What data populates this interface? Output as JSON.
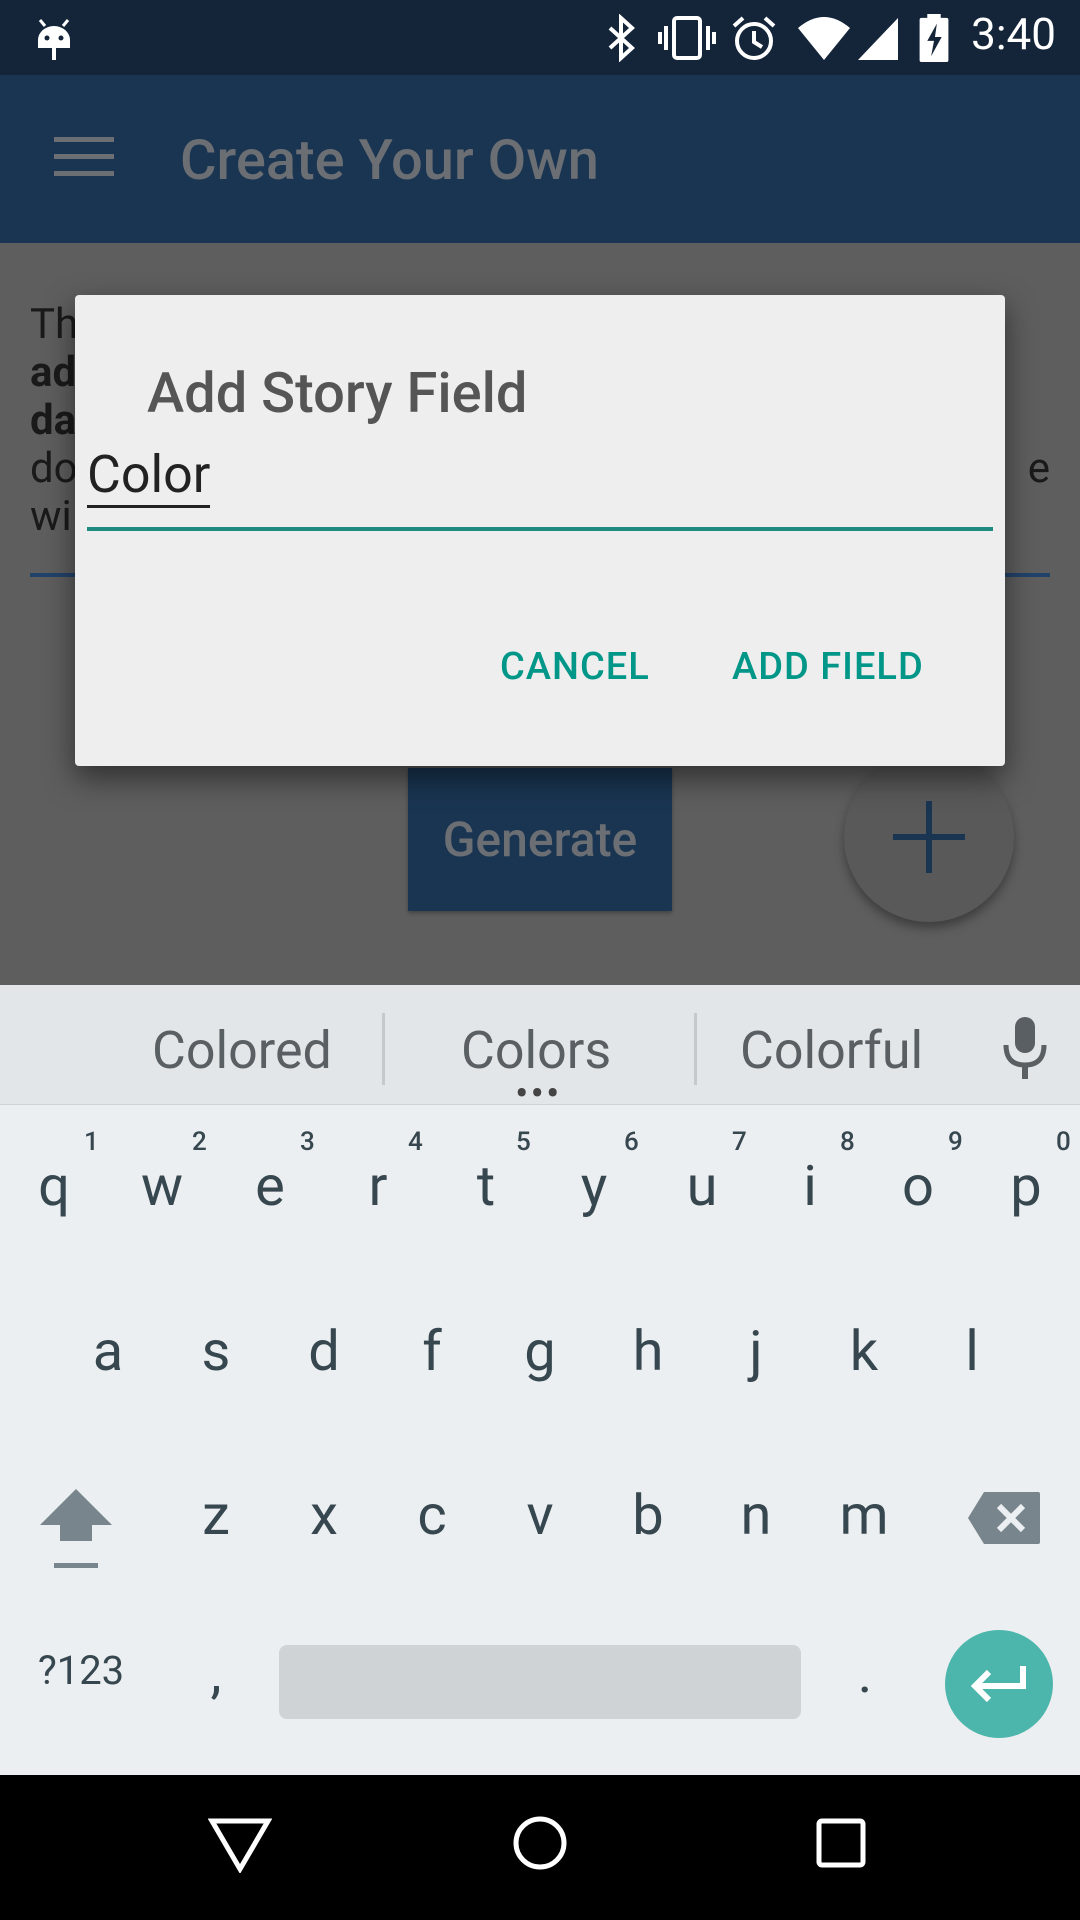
{
  "status_bar": {
    "time": "3:40",
    "icons": [
      "android-debug-icon",
      "bluetooth-icon",
      "vibrate-icon",
      "alarm-icon",
      "wifi-icon",
      "signal-icon",
      "battery-charging-icon"
    ]
  },
  "app_bar": {
    "title": "Create Your Own",
    "menu_icon": "hamburger-menu-icon"
  },
  "content": {
    "desc_line1": "Th",
    "desc_line2": "ad",
    "desc_line3": "da",
    "desc_line4": "do",
    "desc_line4_end": "e",
    "desc_line5": "wi",
    "generate_label": "Generate",
    "fab_icon": "plus-icon"
  },
  "dialog": {
    "title": "Add Story Field",
    "input_value": "Color",
    "cancel_label": "CANCEL",
    "add_label": "ADD FIELD"
  },
  "keyboard": {
    "suggestions": [
      "Colored",
      "Colors",
      "Colorful"
    ],
    "suggestion_more": "•••",
    "row1": [
      "q",
      "w",
      "e",
      "r",
      "t",
      "y",
      "u",
      "i",
      "o",
      "p"
    ],
    "row1_hints": [
      "1",
      "2",
      "3",
      "4",
      "5",
      "6",
      "7",
      "8",
      "9",
      "0"
    ],
    "row2": [
      "a",
      "s",
      "d",
      "f",
      "g",
      "h",
      "j",
      "k",
      "l"
    ],
    "row3": [
      "z",
      "x",
      "c",
      "v",
      "b",
      "n",
      "m"
    ],
    "symbols_label": "?123",
    "comma": ",",
    "period": "."
  },
  "colors": {
    "status_bar": "#14253a",
    "app_bar": "#1a3552",
    "accent": "#009688",
    "enter_key": "#4db6ac"
  }
}
